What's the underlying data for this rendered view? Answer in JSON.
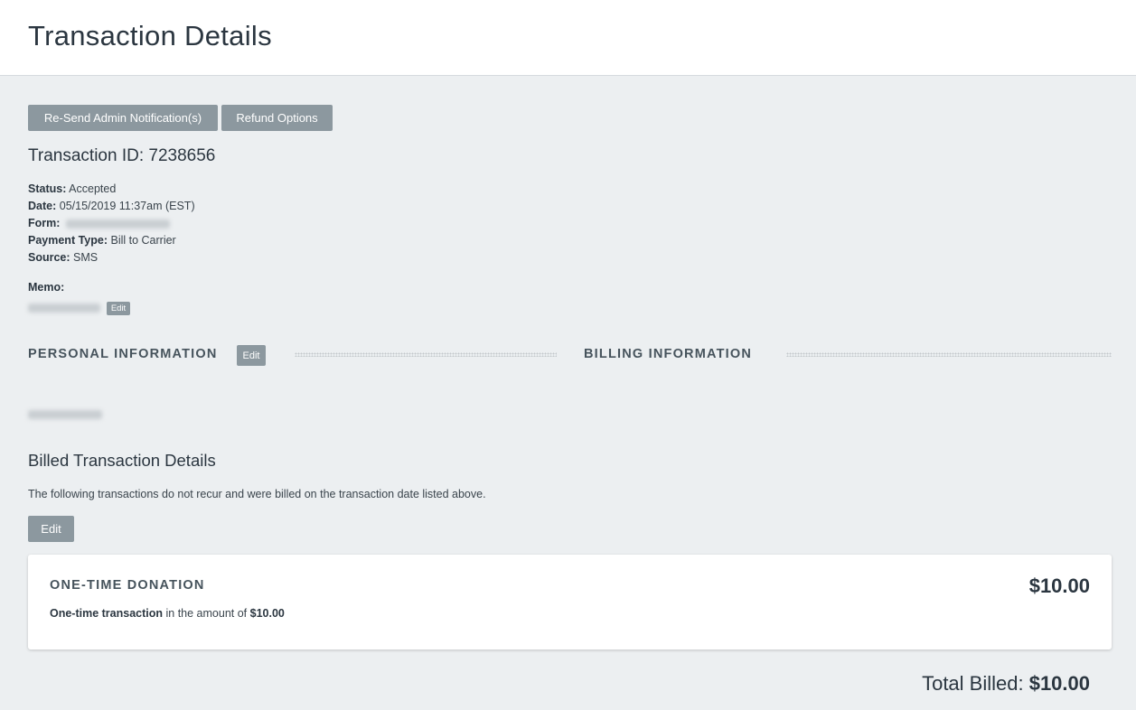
{
  "header": {
    "title": "Transaction Details"
  },
  "actions": {
    "resend_label": "Re-Send Admin Notification(s)",
    "refund_label": "Refund Options"
  },
  "transaction": {
    "id_label": "Transaction ID:",
    "id": "7238656",
    "status_label": "Status:",
    "status": "Accepted",
    "date_label": "Date:",
    "date": "05/15/2019 11:37am (EST)",
    "form_label": "Form:",
    "payment_type_label": "Payment Type:",
    "payment_type": "Bill to Carrier",
    "source_label": "Source:",
    "source": "SMS",
    "memo_label": "Memo:",
    "memo_edit_label": "Edit"
  },
  "personal": {
    "title": "PERSONAL INFORMATION",
    "edit_label": "Edit"
  },
  "billing": {
    "title": "BILLING INFORMATION"
  },
  "billed": {
    "title": "Billed Transaction Details",
    "description": "The following transactions do not recur and were billed on the transaction date listed above.",
    "edit_label": "Edit"
  },
  "donation_card": {
    "title": "ONE-TIME DONATION",
    "amount": "$10.00",
    "line_bold": "One-time transaction",
    "line_text": " in the amount of ",
    "line_amount": "$10.00"
  },
  "total": {
    "label": "Total Billed: ",
    "amount": "$10.00"
  }
}
